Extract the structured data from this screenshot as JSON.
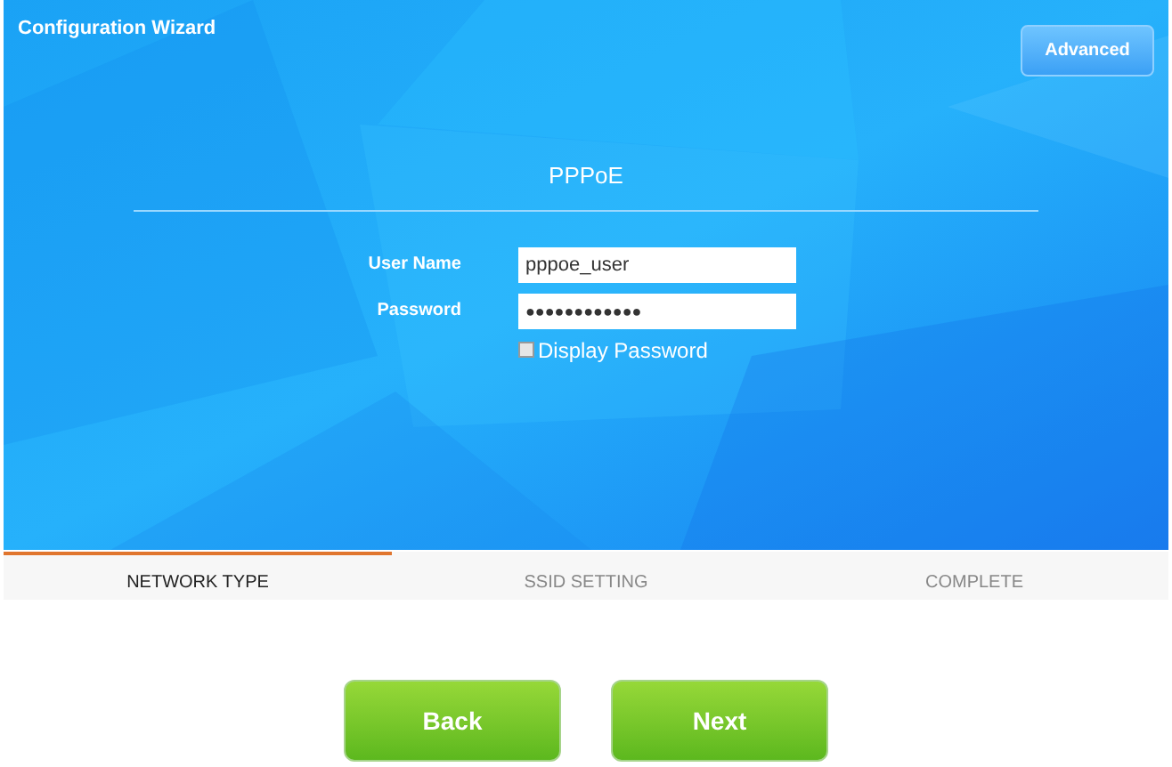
{
  "window": {
    "title": "Configuration Wizard"
  },
  "advanced_button": "Advanced",
  "section_title": "PPPoE",
  "fields": [
    {
      "label": "User Name",
      "value": "pppoe_user"
    },
    {
      "label": "Password",
      "value": "●●●●●●●●●●●●"
    }
  ],
  "display_password": {
    "label": "Display Password",
    "checked": false
  },
  "steps": [
    {
      "label": "NETWORK TYPE",
      "selected": true
    },
    {
      "label": "SSID SETTING",
      "selected": false
    },
    {
      "label": "COMPLETE",
      "selected": false
    }
  ],
  "buttons": [
    "Back",
    "Next"
  ]
}
